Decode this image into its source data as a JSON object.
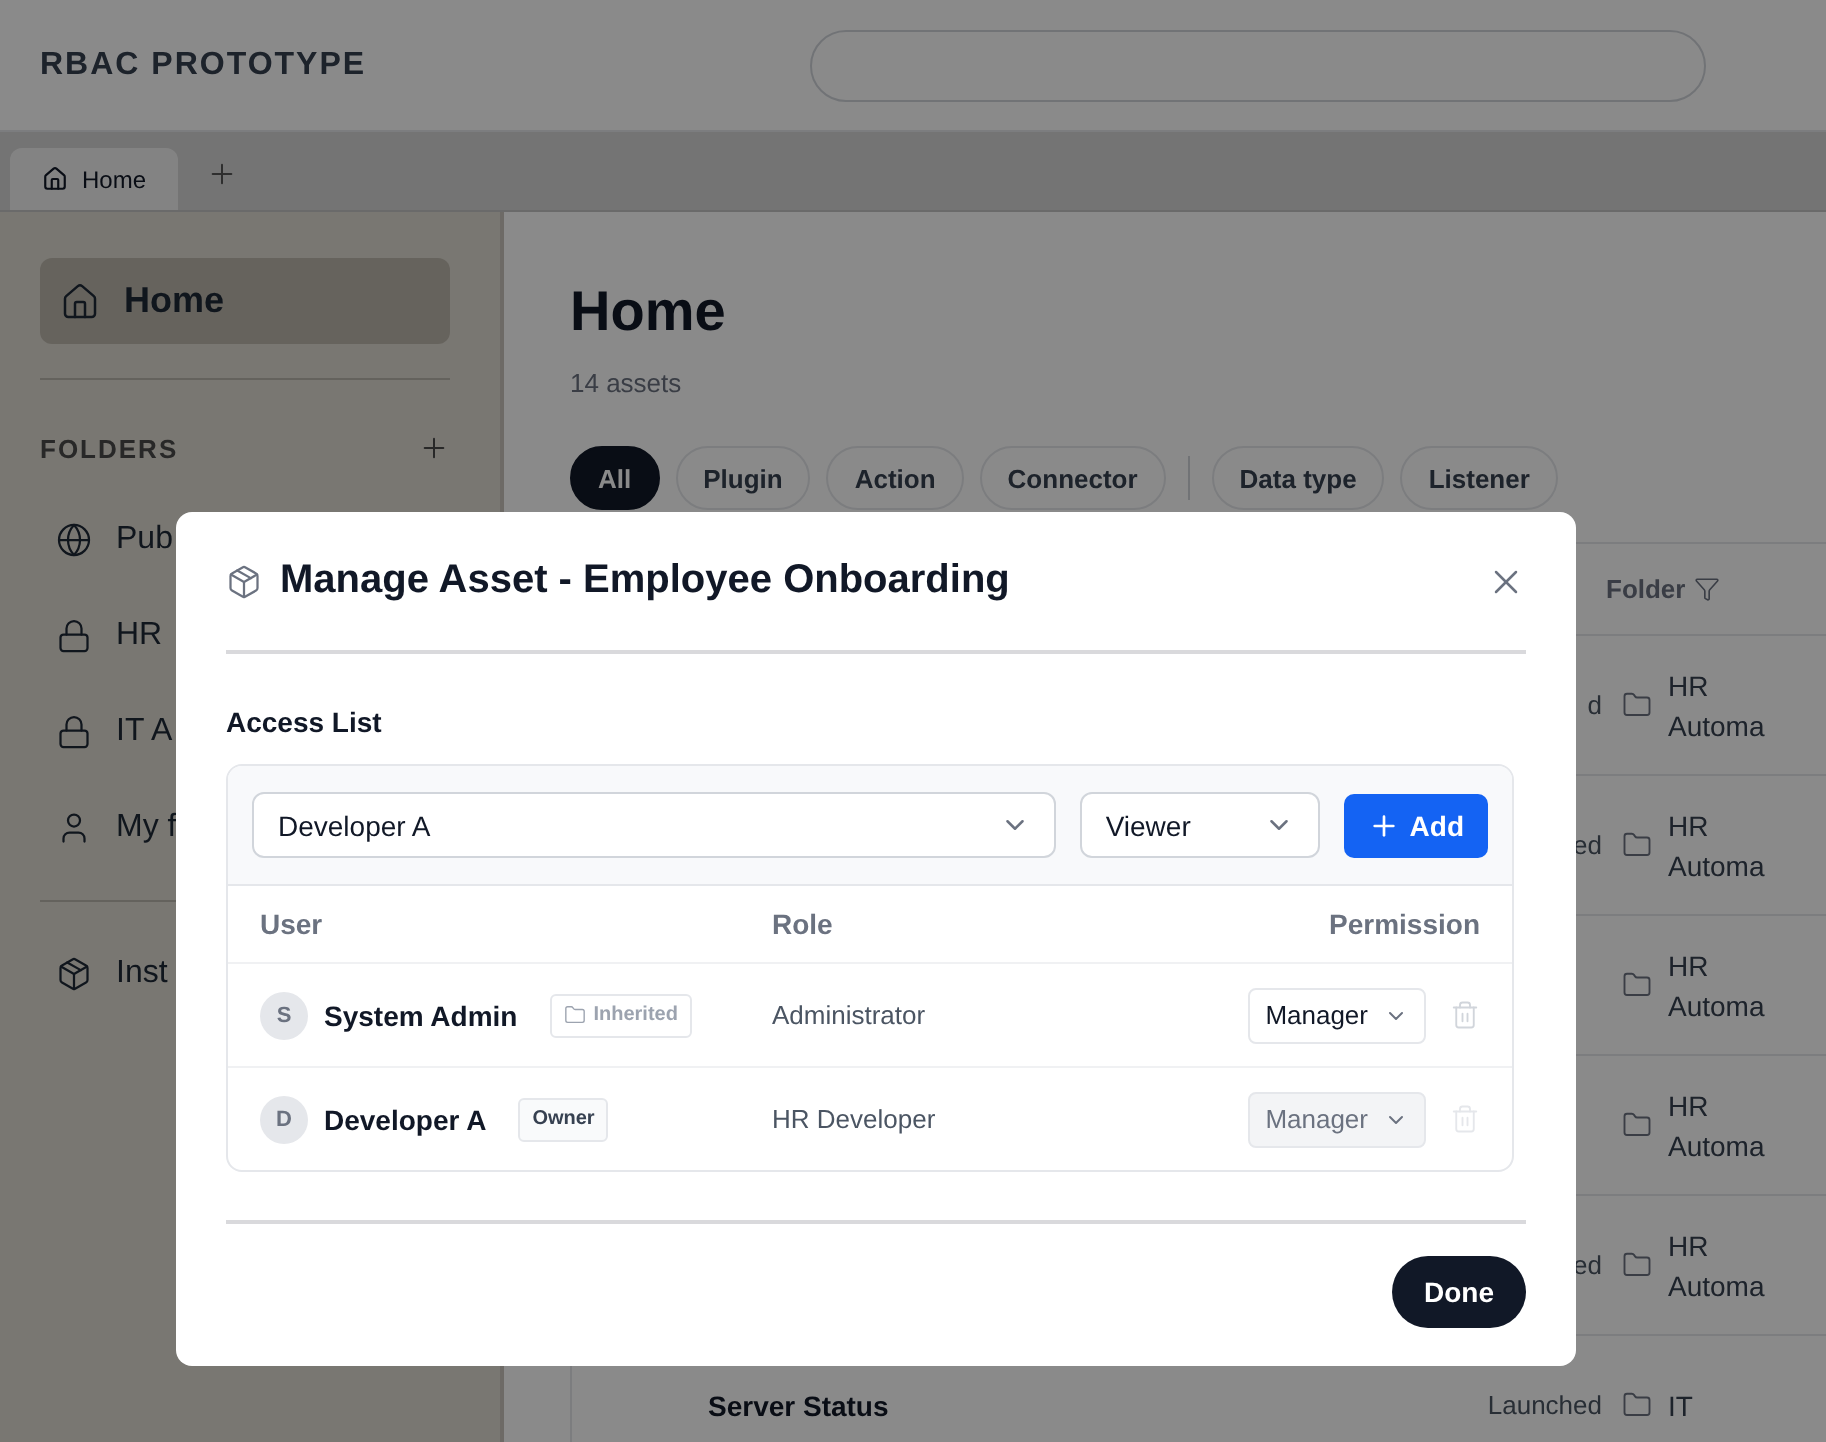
{
  "app": {
    "title": "RBAC PROTOTYPE"
  },
  "tabs": [
    {
      "label": "Home",
      "selected": true
    }
  ],
  "sidebar": {
    "items": [
      {
        "label": "Home",
        "selected": true
      }
    ],
    "folders_heading": "FOLDERS",
    "folders": [
      {
        "label": "Pub"
      },
      {
        "label": "HR"
      },
      {
        "label": "IT A"
      },
      {
        "label": "My f"
      }
    ],
    "extra": [
      {
        "label": "Inst"
      }
    ]
  },
  "page": {
    "title": "Home",
    "subtitle": "14 assets",
    "filter_groups": [
      [
        {
          "label": "All",
          "selected": true
        },
        {
          "label": "Plugin",
          "selected": false
        },
        {
          "label": "Action",
          "selected": false
        },
        {
          "label": "Connector",
          "selected": false
        }
      ],
      [
        {
          "label": "Data type",
          "selected": false
        },
        {
          "label": "Listener",
          "selected": false
        }
      ]
    ]
  },
  "table": {
    "columns": [
      {
        "label": "Folder"
      }
    ],
    "rows": [
      {
        "status": "d",
        "folder": "HR Automa"
      },
      {
        "status": "ed",
        "folder": "HR Automa"
      },
      {
        "folder": "HR Automa"
      },
      {
        "folder": "HR Automa"
      },
      {
        "status": "ed",
        "folder": "HR Automa"
      },
      {
        "name": "Server Status",
        "status": "Launched",
        "folder": "IT"
      }
    ]
  },
  "modal": {
    "title": "Manage Asset - Employee Onboarding",
    "section": "Access List",
    "user_select": {
      "value": "Developer A"
    },
    "role_select": {
      "value": "Viewer"
    },
    "add_button": "Add",
    "columns": [
      "User",
      "Role",
      "Permission"
    ],
    "entries": [
      {
        "initial": "S",
        "name": "System Admin",
        "badge": {
          "kind": "inherited",
          "label": "Inherited"
        },
        "role": "Administrator",
        "permission": "Manager",
        "disabled": false
      },
      {
        "initial": "D",
        "name": "Developer A",
        "badge": {
          "kind": "owner",
          "label": "Owner"
        },
        "role": "HR Developer",
        "permission": "Manager",
        "disabled": true
      }
    ],
    "done_button": "Done"
  }
}
